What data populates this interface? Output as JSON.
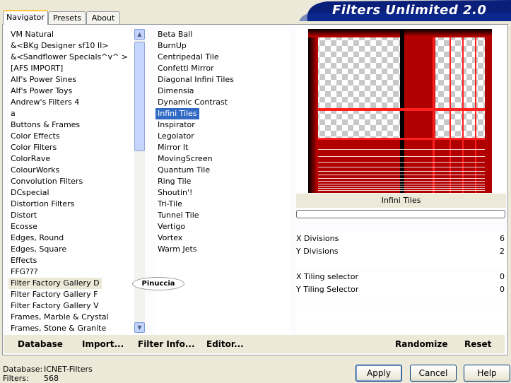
{
  "app": {
    "title": "Filters Unlimited 2.0"
  },
  "tabs": [
    "Navigator",
    "Presets",
    "About"
  ],
  "categories": [
    "VM Natural",
    "&<BKg Designer sf10 II>",
    "&<Sandflower Specials^v^ >",
    "[AFS IMPORT]",
    "Alf's Power Sines",
    "Alf's Power Toys",
    "Andrew's Filters 4",
    "a",
    "Buttons & Frames",
    "Color Effects",
    "Color Filters",
    "ColorRave",
    "ColourWorks",
    "Convolution Filters",
    "DCspecial",
    "Distortion Filters",
    "Distort",
    "Ecosse",
    "Edges, Round",
    "Edges, Square",
    "Effects",
    "FFG???",
    "Filter Factory Gallery D",
    "Filter Factory Gallery F",
    "Filter Factory Gallery V",
    "Frames, Marble & Crystal",
    "Frames, Stone & Granite"
  ],
  "filters": [
    "Beta Ball",
    "BurnUp",
    "Centripedal Tile",
    "Confetti Mirror",
    "Diagonal Infini Tiles",
    "Dimensia",
    "Dynamic Contrast",
    "Infini Tiles",
    "Inspirator",
    "Legolator",
    "Mirror It",
    "MovingScreen",
    "Quantum Tile",
    "Ring Tile",
    "Shoutin'!",
    "Tri-Tile",
    "Tunnel Tile",
    "Vertigo",
    "Vortex",
    "Warm Jets"
  ],
  "selected_category": "Filter Factory Gallery D",
  "selected_filter": "Infini Tiles",
  "watermark": "Pinuccia",
  "preview": {
    "caption": "Infini Tiles",
    "accent_color": "#cc0000"
  },
  "params": [
    {
      "label": "X Divisions",
      "value": "6"
    },
    {
      "label": "Y Divisions",
      "value": "2"
    },
    {
      "label": "X Tiling selector",
      "value": "0"
    },
    {
      "label": "Y Tiling Selector",
      "value": "0"
    }
  ],
  "left_buttons": {
    "database": "Database",
    "import": "Import...",
    "filter_info": "Filter Info...",
    "editor": "Editor..."
  },
  "right_buttons": {
    "randomize": "Randomize",
    "reset": "Reset"
  },
  "status": {
    "database_label": "Database:",
    "database_value": "ICNET-Filters",
    "filters_label": "Filters:",
    "filters_value": "568"
  },
  "dialog_buttons": {
    "apply": "Apply",
    "cancel": "Cancel",
    "help": "Help"
  }
}
